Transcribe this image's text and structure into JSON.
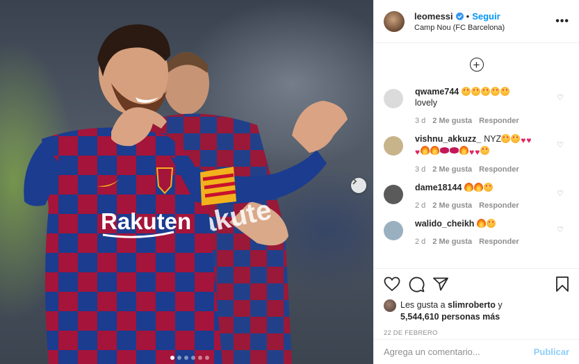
{
  "header": {
    "username": "leomessi",
    "separator": "•",
    "follow_label": "Seguir",
    "location": "Camp Nou (FC Barcelona)",
    "more_label": "•••"
  },
  "comments": [
    {
      "user": "qwame744",
      "text": "",
      "line2": "lovely",
      "emojis": [
        "face",
        "face",
        "face",
        "face",
        "face"
      ],
      "emojis2": [],
      "age": "3 d",
      "likes": "2 Me gusta",
      "reply": "Responder",
      "avatar_color": "#dbdbdb"
    },
    {
      "user": "vishnu_akkuzz_",
      "text": "NYZ",
      "line2": "",
      "emojis": [
        "face",
        "face",
        "heart",
        "heart"
      ],
      "emojis2": [
        "heart",
        "fire",
        "fire",
        "lips",
        "lips",
        "fire",
        "heart",
        "heart",
        "face"
      ],
      "age": "3 d",
      "likes": "2 Me gusta",
      "reply": "Responder",
      "avatar_color": "#c8b48a"
    },
    {
      "user": "dame18144",
      "text": "",
      "line2": "",
      "emojis": [
        "fire",
        "fire",
        "face"
      ],
      "emojis2": [],
      "age": "2 d",
      "likes": "2 Me gusta",
      "reply": "Responder",
      "avatar_color": "#5a5a5a"
    },
    {
      "user": "walido_cheikh",
      "text": "",
      "line2": "",
      "emojis": [
        "fire",
        "face"
      ],
      "emojis2": [],
      "age": "2 d",
      "likes": "2 Me gusta",
      "reply": "Responder",
      "avatar_color": "#9ab0c0"
    }
  ],
  "likes": {
    "prefix": "Les gusta a",
    "user": "slimroberto",
    "connector": "y",
    "count": "5,544,610 personas más"
  },
  "date": "22 DE FEBRERO",
  "add_comment": {
    "placeholder": "Agrega un comentario...",
    "publish_label": "Publicar"
  },
  "photo": {
    "shirt_sponsor": "Rakuten",
    "shirt_sponsor_back": "Rakute",
    "carousel_dots": 6,
    "active_dot": 0
  },
  "colors": {
    "blue_link": "#0095f6",
    "text": "#262626",
    "muted": "#8e8e8e",
    "barca_blue": "#1b3c8f",
    "barca_red": "#a5143a"
  }
}
